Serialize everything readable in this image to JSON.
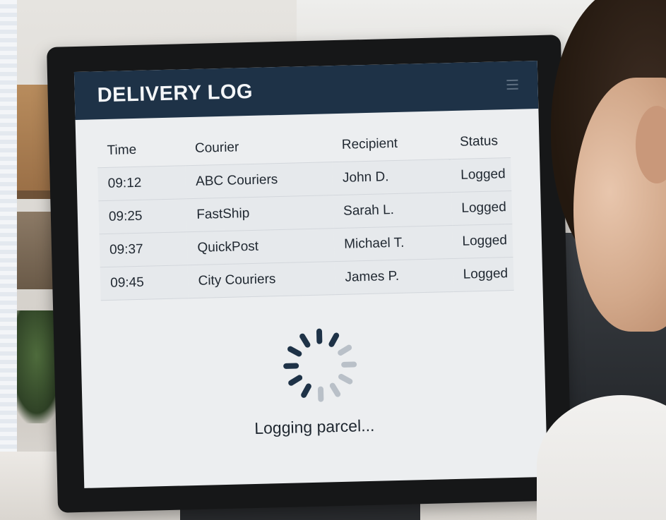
{
  "app": {
    "title": "DELIVERY LOG"
  },
  "log_table": {
    "columns": [
      "Time",
      "Courier",
      "Recipient",
      "Status"
    ],
    "rows": [
      {
        "time": "09:12",
        "courier": "ABC Couriers",
        "recipient": "John D.",
        "status": "Logged"
      },
      {
        "time": "09:25",
        "courier": "FastShip",
        "recipient": "Sarah L.",
        "status": "Logged"
      },
      {
        "time": "09:37",
        "courier": "QuickPost",
        "recipient": "Michael T.",
        "status": "Logged"
      },
      {
        "time": "09:45",
        "courier": "City Couriers",
        "recipient": "James P.",
        "status": "Logged"
      }
    ]
  },
  "loading": {
    "message": "Logging parcel..."
  },
  "colors": {
    "header_bg": "#1e3247",
    "spinner_dark": "#1e3247",
    "spinner_light": "#b9c0c8"
  },
  "icons": {
    "spinner": "loading-spinner-icon",
    "menu": "menu-icon"
  }
}
